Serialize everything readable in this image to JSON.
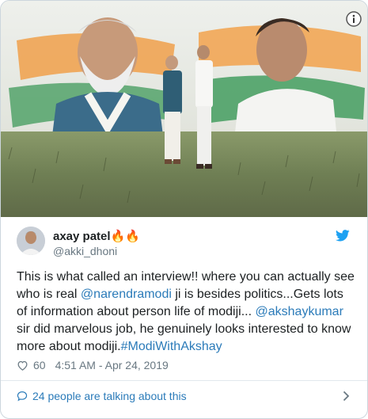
{
  "author": {
    "name": "axay patel🔥🔥",
    "handle": "@akki_dhoni"
  },
  "tweet": {
    "part1": "This is what called an interview!! where you can actually see who is real ",
    "mention1": "@narendramodi",
    "part2": " ji is besides politics...Gets lots of information about person life of modiji... ",
    "mention2": "@akshaykumar",
    "part3": " sir did marvelous job, he genuinely looks interested to know more about modiji.",
    "hashtag": "#ModiWithAkshay"
  },
  "likes": "60",
  "timestamp": "4:51 AM - Apr 24, 2019",
  "conversation": {
    "label": "24 people are talking about this"
  },
  "icons": {
    "info": "info-icon",
    "twitter": "twitter-bird-icon",
    "like": "heart-icon",
    "conversation": "speech-bubble-icon",
    "chevron": "chevron-right-icon"
  },
  "colors": {
    "link": "#2b7bb9",
    "secondary_text": "#697882",
    "primary_text": "#1c2022",
    "twitter_blue": "#1da1f2",
    "border": "#ccd6dd"
  }
}
